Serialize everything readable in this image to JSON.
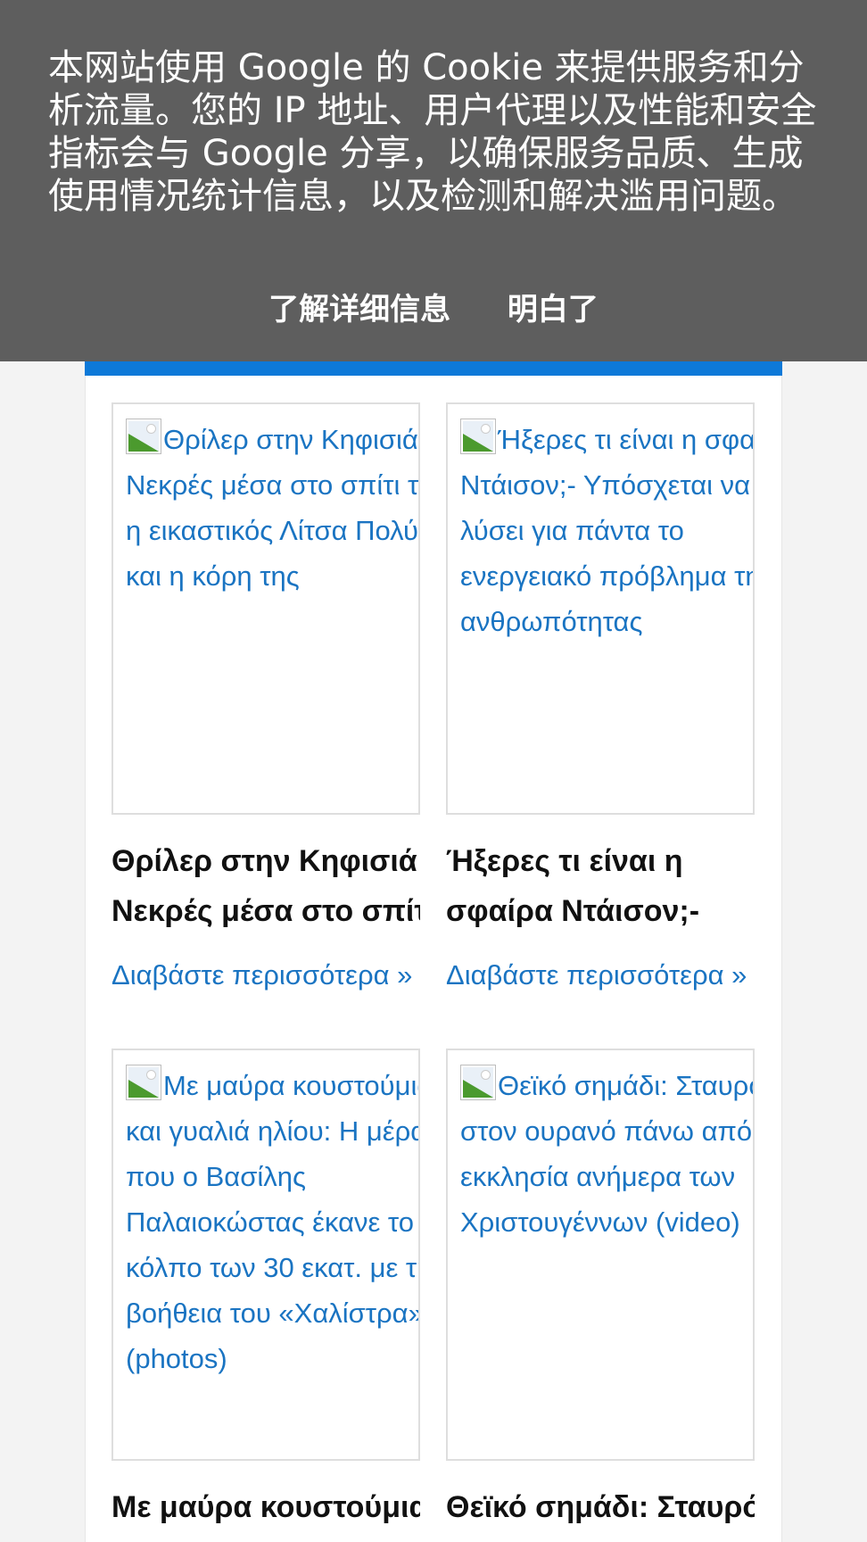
{
  "cookie_banner": {
    "message": "本网站使用 Google 的 Cookie 来提供服务和分析流量。您的 IP 地址、用户代理以及性能和安全指标会与 Google 分享，以确保服务品质、生成使用情况统计信息，以及检测和解决滥用问题。",
    "learn_more_label": "了解详细信息",
    "accept_label": "明白了",
    "background_color": "#5e5e5e"
  },
  "theme": {
    "accent_color": "#0d79d8",
    "link_color": "#1a74c2"
  },
  "articles": [
    {
      "image_alt": "Θρίλερ στην Κηφισιά: Νεκρές μέσα στο σπίτι τους η εικαστικός Λίτσα Πολύζου και η κόρη της",
      "headline_line1": "Θρίλερ στην Κηφισιά:",
      "headline_line2": "Νεκρές μέσα στο σπίτι",
      "read_more": "Διαβάστε περισσότερα »",
      "image_icon": "broken-image-icon"
    },
    {
      "image_alt": "Ήξερες τι είναι η σφαίρα Ντάισον;- Υπόσχεται να λύσει για πάντα το ενεργειακό πρόβλημα της ανθρωπότητας",
      "headline_line1": "Ήξερες τι είναι η",
      "headline_line2": "σφαίρα Ντάισον;-",
      "read_more": "Διαβάστε περισσότερα »",
      "image_icon": "broken-image-icon"
    },
    {
      "image_alt": "Με μαύρα κουστούμια και γυαλιά ηλίου: Η μέρα που ο Βασίλης Παλαιοκώστας έκανε το κόλπο των 30 εκατ. με τη βοήθεια του «Χαλίστρα» (photos)",
      "headline_line1": "Με μαύρα κουστούμια",
      "headline_line2": "",
      "read_more": "",
      "image_icon": "broken-image-icon"
    },
    {
      "image_alt": "Θεϊκό σημάδι: Σταυρός στον ουρανό πάνω από μια εκκλησία ανήμερα των Χριστουγέννων (video)",
      "headline_line1": "Θεϊκό σημάδι: Σταυρός",
      "headline_line2": "",
      "read_more": "",
      "image_icon": "broken-image-icon"
    }
  ]
}
